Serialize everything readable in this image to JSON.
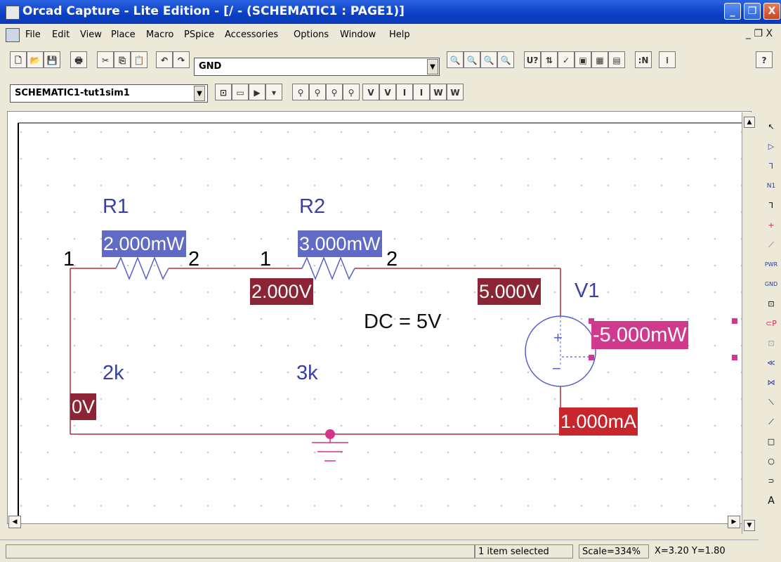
{
  "window": {
    "title": "Orcad Capture - Lite Edition - [/ - (SCHEMATIC1 : PAGE1)]",
    "minimize_glyph": "_",
    "restore_glyph": "❐",
    "close_glyph": "X"
  },
  "menu": {
    "items": [
      "File",
      "Edit",
      "View",
      "Place",
      "Macro",
      "PSpice",
      "Accessories",
      "Options",
      "Window",
      "Help"
    ],
    "mdi_restore": "_ ❐ X"
  },
  "toolbar1": {
    "part_combo_value": "GND",
    "button_glyphs": [
      "🗋",
      "📂",
      "💾",
      "🖶",
      "✂",
      "⎘",
      "📋",
      "↶",
      "↷",
      "🔍",
      "🔍",
      "🔍",
      "🔍",
      "U?",
      "⇅",
      "✓",
      "▣",
      "▦",
      "▤",
      ":N",
      "⁞",
      "?"
    ]
  },
  "toolbar2": {
    "profile_combo_value": "SCHEMATIC1-tut1sim1",
    "button_glyphs": [
      "⊡",
      "▭",
      "▶",
      "▾",
      "⚲",
      "⚲",
      "⚲",
      "⚲",
      "V",
      "V",
      "I",
      "I",
      "W",
      "W"
    ]
  },
  "schematic": {
    "r1": {
      "ref": "R1",
      "value": "2k",
      "power": "2.000mW",
      "pin1": "1",
      "pin2": "2"
    },
    "r2": {
      "ref": "R2",
      "value": "3k",
      "power": "3.000mW",
      "pin1": "1",
      "pin2": "2"
    },
    "v1": {
      "ref": "V1",
      "dc": "DC = 5V",
      "power": "-5.000mW",
      "plus": "+",
      "minus": "−"
    },
    "node_voltages": {
      "left": "0V",
      "mid": "2.000V",
      "right": "5.000V"
    },
    "branch_current": "1.000mA",
    "colors": {
      "wire": "#b52a3a",
      "ground": "#d6338a",
      "symbol": "#5560c8"
    }
  },
  "palette": {
    "tools": [
      "↖",
      "▷",
      "⅂",
      "N1",
      "⅂",
      "+",
      "⟋",
      "PWR",
      "GND",
      "⊡",
      "⊂P",
      "⊡",
      "≪",
      "⋈",
      "⟍",
      "⟋",
      "□",
      "○",
      "⊃",
      "A"
    ]
  },
  "status": {
    "message": "",
    "selection": "1 item selected",
    "scale": "Scale=334%",
    "coords": "X=3.20  Y=1.80"
  }
}
